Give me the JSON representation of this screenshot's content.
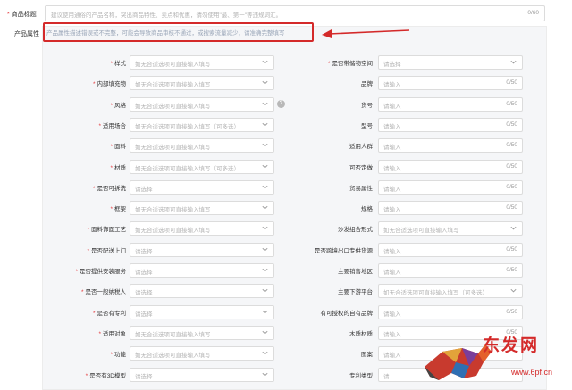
{
  "title": {
    "required_mark": "*",
    "label": "商品标题",
    "placeholder": "建议使用通俗的产品名称，突出商品特性、卖点和优惠，请勿使用\"最、第一\"等违规词汇。",
    "count": "0/60"
  },
  "attributes": {
    "label": "产品属性",
    "warning": "产品属性描述错误或不完整，可能会导致商品审核不通过，或搜索流量减少，请准确完整填写"
  },
  "left_fields": [
    {
      "label": "样式",
      "required": "*",
      "placeholder": "如无合适选项可直接输入填写",
      "kind": "select"
    },
    {
      "label": "内部填充物",
      "required": "*",
      "placeholder": "如无合适选项可直接输入填写",
      "kind": "select"
    },
    {
      "label": "风格",
      "required": "*",
      "placeholder": "如无合适选项可直接输入填写",
      "kind": "select"
    },
    {
      "label": "适用场合",
      "required": "*",
      "placeholder": "如无合适选项可直接输入填写（可多选）",
      "kind": "select"
    },
    {
      "label": "面料",
      "required": "*",
      "placeholder": "如无合适选项可直接输入填写",
      "kind": "select"
    },
    {
      "label": "材质",
      "required": "*",
      "placeholder": "如无合适选项可直接输入填写（可多选）",
      "kind": "select"
    },
    {
      "label": "是否可拆洗",
      "required": "*",
      "placeholder": "请选择",
      "kind": "select"
    },
    {
      "label": "框架",
      "required": "*",
      "placeholder": "如无合适选项可直接输入填写",
      "kind": "select"
    },
    {
      "label": "面料饰面工艺",
      "required": "*",
      "placeholder": "如无合适选项可直接输入填写",
      "kind": "select"
    },
    {
      "label": "是否配送上门",
      "required": "*",
      "placeholder": "请选择",
      "kind": "select"
    },
    {
      "label": "是否提供安装服务",
      "required": "*",
      "placeholder": "请选择",
      "kind": "select"
    },
    {
      "label": "是否一般纳税人",
      "required": "*",
      "placeholder": "请选择",
      "kind": "select"
    },
    {
      "label": "是否有专利",
      "required": "*",
      "placeholder": "请选择",
      "kind": "select"
    },
    {
      "label": "适用对象",
      "required": "*",
      "placeholder": "如无合适选项可直接输入填写",
      "kind": "select"
    },
    {
      "label": "功能",
      "required": "*",
      "placeholder": "如无合适选项可直接输入填写",
      "kind": "select"
    },
    {
      "label": "是否有3D模型",
      "required": "*",
      "placeholder": "请选择",
      "kind": "select"
    }
  ],
  "right_fields": [
    {
      "label": "是否带储物空间",
      "required": "*",
      "placeholder": "请选择",
      "kind": "select",
      "count": ""
    },
    {
      "label": "品牌",
      "required": "",
      "placeholder": "请输入",
      "kind": "input",
      "count": "0/50"
    },
    {
      "label": "货号",
      "required": "",
      "placeholder": "请输入",
      "kind": "input",
      "count": "0/50"
    },
    {
      "label": "型号",
      "required": "",
      "placeholder": "请输入",
      "kind": "input",
      "count": "0/50"
    },
    {
      "label": "适用人群",
      "required": "",
      "placeholder": "请输入",
      "kind": "input",
      "count": "0/50"
    },
    {
      "label": "可否定做",
      "required": "",
      "placeholder": "请输入",
      "kind": "input",
      "count": "0/50"
    },
    {
      "label": "贸易属性",
      "required": "",
      "placeholder": "请输入",
      "kind": "input",
      "count": "0/50"
    },
    {
      "label": "规格",
      "required": "",
      "placeholder": "请输入",
      "kind": "input",
      "count": "0/50"
    },
    {
      "label": "沙发组合形式",
      "required": "",
      "placeholder": "如无合适选项可直接输入填写",
      "kind": "select",
      "count": ""
    },
    {
      "label": "是否跨境出口专供货源",
      "required": "",
      "placeholder": "请输入",
      "kind": "input",
      "count": "0/50"
    },
    {
      "label": "主要销售地区",
      "required": "",
      "placeholder": "请输入",
      "kind": "input",
      "count": "0/50"
    },
    {
      "label": "主要下游平台",
      "required": "",
      "placeholder": "如无合适选项可直接输入填写（可多选）",
      "kind": "select",
      "count": ""
    },
    {
      "label": "有可授权的自有品牌",
      "required": "",
      "placeholder": "请输入",
      "kind": "input",
      "count": "0/50"
    },
    {
      "label": "木质材质",
      "required": "",
      "placeholder": "请输入",
      "kind": "input",
      "count": "0/50"
    },
    {
      "label": "图案",
      "required": "",
      "placeholder": "请输入",
      "kind": "input",
      "count": ""
    },
    {
      "label": "专利类型",
      "required": "",
      "placeholder": "请",
      "kind": "input",
      "count": ""
    }
  ],
  "watermark": {
    "text": "东发网",
    "url": "www.6pf.cn"
  },
  "icons": {
    "chevron": "chevron-down-icon",
    "info": "info-icon",
    "arrow": "red-arrow-icon"
  },
  "colors": {
    "required": "#e4393c",
    "highlight": "#d42a2a",
    "panel": "#f5f6f8"
  }
}
